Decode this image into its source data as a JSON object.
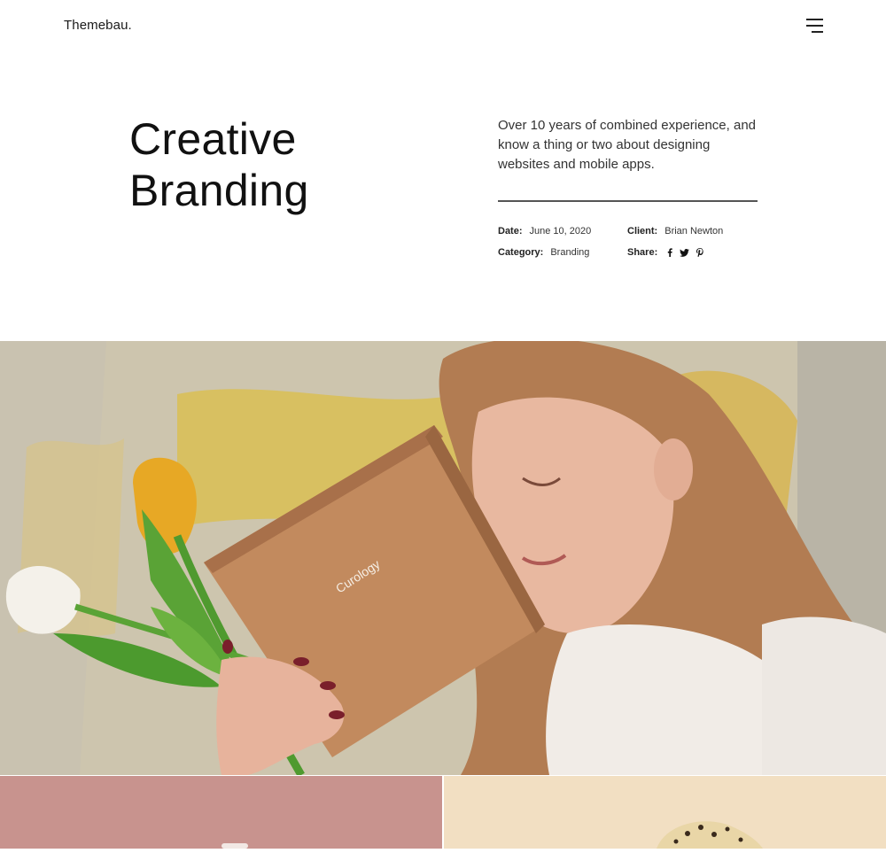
{
  "header": {
    "logo": "Themebau."
  },
  "hero_text": {
    "title_line1": "Creative",
    "title_line2": "Branding",
    "description": "Over 10 years of combined experience, and know a thing or two about designing websites and mobile apps."
  },
  "meta": {
    "date_label": "Date:",
    "date_value": "June 10, 2020",
    "client_label": "Client:",
    "client_value": "Brian Newton",
    "category_label": "Category:",
    "category_value": "Branding",
    "share_label": "Share:"
  },
  "share_icons": [
    "facebook-icon",
    "twitter-icon",
    "pinterest-icon"
  ],
  "box_label": "Curology",
  "colors": {
    "bottom_left_bg": "#c8938e",
    "bottom_right_bg": "#f2dfc2",
    "divider": "#555555"
  }
}
